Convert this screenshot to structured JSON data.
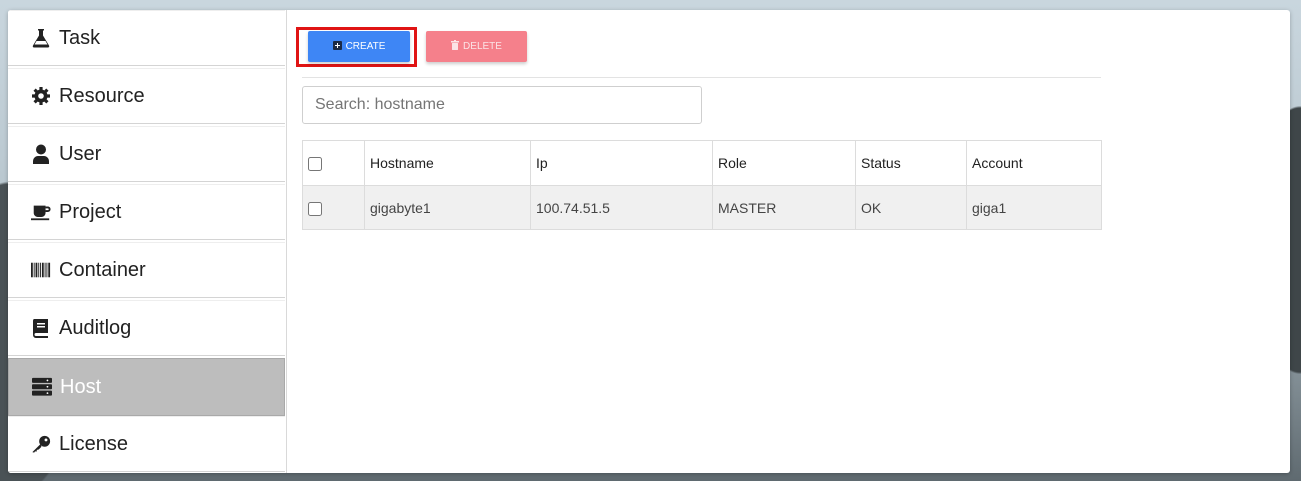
{
  "sidebar": {
    "items": [
      {
        "label": "Task",
        "icon": "flask-icon"
      },
      {
        "label": "Resource",
        "icon": "gear-icon"
      },
      {
        "label": "User",
        "icon": "user-icon"
      },
      {
        "label": "Project",
        "icon": "coffee-icon"
      },
      {
        "label": "Container",
        "icon": "barcode-icon"
      },
      {
        "label": "Auditlog",
        "icon": "book-icon"
      },
      {
        "label": "Host",
        "icon": "server-icon",
        "active": true
      },
      {
        "label": "License",
        "icon": "key-icon"
      }
    ]
  },
  "toolbar": {
    "create_label": "CREATE",
    "delete_label": "DELETE"
  },
  "search": {
    "placeholder": "Search: hostname",
    "value": ""
  },
  "table": {
    "columns": [
      "Hostname",
      "Ip",
      "Role",
      "Status",
      "Account"
    ],
    "rows": [
      {
        "hostname": "gigabyte1",
        "ip": "100.74.51.5",
        "role": "MASTER",
        "status": "OK",
        "account": "giga1"
      }
    ]
  },
  "colors": {
    "create": "#3e86f5",
    "delete": "#f5808b",
    "highlight": "#e01414",
    "active_nav": "#bdbdbd"
  }
}
